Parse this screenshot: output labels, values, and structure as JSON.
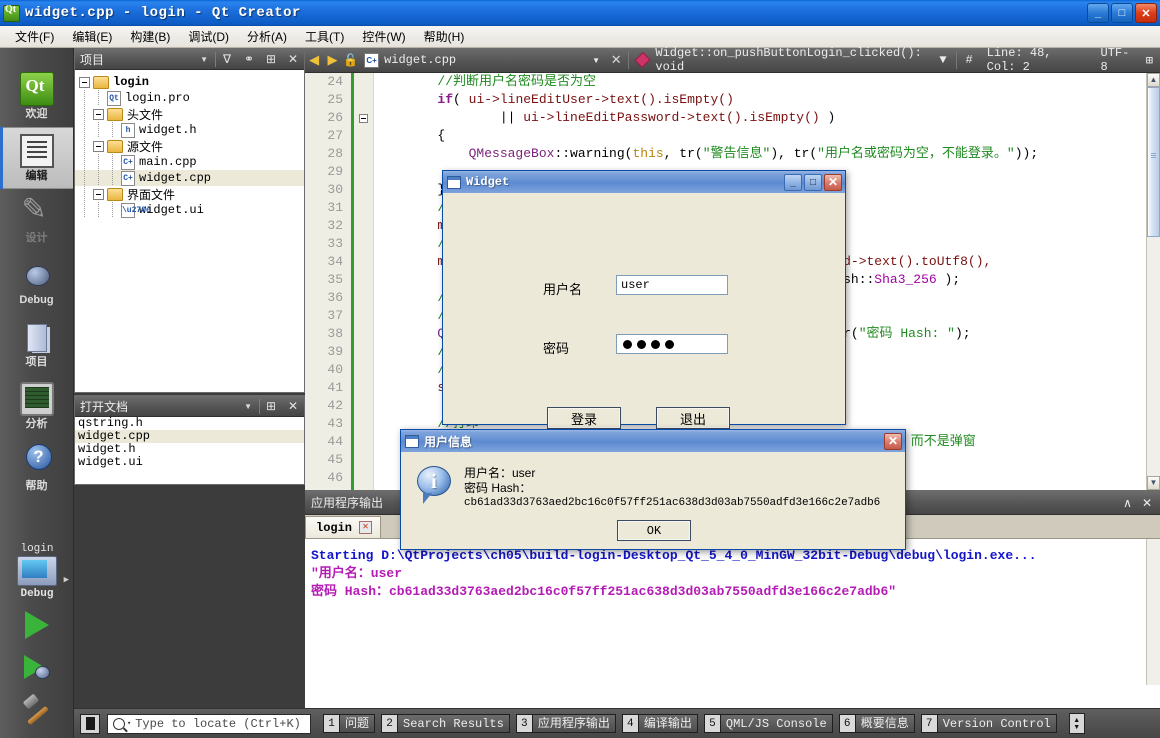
{
  "window": {
    "title": "widget.cpp - login - Qt Creator",
    "icon": "qt-logo-icon",
    "minimize": "_",
    "maximize": "□",
    "close": "✕"
  },
  "menubar": {
    "items": [
      {
        "label": "文件(F)"
      },
      {
        "label": "编辑(E)"
      },
      {
        "label": "构建(B)"
      },
      {
        "label": "调试(D)"
      },
      {
        "label": "分析(A)"
      },
      {
        "label": "工具(T)"
      },
      {
        "label": "控件(W)"
      },
      {
        "label": "帮助(H)"
      }
    ]
  },
  "modebar": {
    "items": [
      {
        "label": "欢迎",
        "icon": "qt-logo-icon",
        "state": "normal"
      },
      {
        "label": "编辑",
        "icon": "edit-lines-icon",
        "state": "active"
      },
      {
        "label": "设计",
        "icon": "design-pencil-icon",
        "state": "disabled"
      },
      {
        "label": "Debug",
        "icon": "bug-icon",
        "state": "normal"
      },
      {
        "label": "项目",
        "icon": "projects-book-icon",
        "state": "normal"
      },
      {
        "label": "分析",
        "icon": "analyze-monitor-icon",
        "state": "normal"
      },
      {
        "label": "帮助",
        "icon": "help-question-icon",
        "state": "normal"
      }
    ],
    "kit": {
      "project": "login",
      "icon": "computer-kit-icon",
      "build_config": "Debug",
      "arrow": "▶"
    },
    "run_buttons": [
      {
        "name": "run-button",
        "icon": "green-play-icon"
      },
      {
        "name": "debug-button",
        "icon": "green-play-bug-icon"
      },
      {
        "name": "build-button",
        "icon": "hammer-icon"
      }
    ]
  },
  "project_dock": {
    "title": "项目",
    "caret": "▼",
    "toolbar": [
      {
        "name": "filter-icon",
        "glyph": "∇"
      },
      {
        "name": "link-icon",
        "glyph": "⚭"
      },
      {
        "name": "split-icon",
        "glyph": "⊞"
      },
      {
        "name": "close-icon",
        "glyph": "✕"
      }
    ],
    "tree": [
      {
        "label": "login",
        "depth": 0,
        "expander": true,
        "icon": "qt-project-folder-icon",
        "bold": true,
        "selected": false
      },
      {
        "label": "login.pro",
        "depth": 1,
        "expander": false,
        "icon": "pro-file-icon",
        "bold": false,
        "selected": false
      },
      {
        "label": "头文件",
        "depth": 1,
        "expander": true,
        "icon": "folder-h-icon",
        "bold": false,
        "selected": false
      },
      {
        "label": "widget.h",
        "depth": 2,
        "expander": false,
        "icon": "h-file-icon",
        "bold": false,
        "selected": false
      },
      {
        "label": "源文件",
        "depth": 1,
        "expander": true,
        "icon": "folder-cpp-icon",
        "bold": false,
        "selected": false
      },
      {
        "label": "main.cpp",
        "depth": 2,
        "expander": false,
        "icon": "cpp-file-icon",
        "bold": false,
        "selected": false
      },
      {
        "label": "widget.cpp",
        "depth": 2,
        "expander": false,
        "icon": "cpp-file-icon",
        "bold": false,
        "selected": true
      },
      {
        "label": "界面文件",
        "depth": 1,
        "expander": true,
        "icon": "folder-ui-icon",
        "bold": false,
        "selected": false
      },
      {
        "label": "widget.ui",
        "depth": 2,
        "expander": false,
        "icon": "ui-file-icon",
        "bold": false,
        "selected": false
      }
    ]
  },
  "opendocs_dock": {
    "title": "打开文档",
    "caret": "▼",
    "toolbar": [
      {
        "name": "split-icon",
        "glyph": "⊞"
      },
      {
        "name": "close-icon",
        "glyph": "✕"
      }
    ],
    "items": [
      {
        "label": "qstring.h",
        "selected": false
      },
      {
        "label": "widget.cpp",
        "selected": true
      },
      {
        "label": "widget.h",
        "selected": false
      },
      {
        "label": "widget.ui",
        "selected": false
      }
    ]
  },
  "editor": {
    "toolbar": {
      "back_icon": "◀",
      "forward_icon": "▶",
      "lock_icon": "🔓",
      "file_icon": "cpp-file-icon",
      "filename": "widget.cpp",
      "file_caret": "▼",
      "close_icon": "✕",
      "symbol_icon": "method-symbol-icon",
      "symbol": "Widget::on_pushButtonLogin_clicked(): void",
      "symbol_caret": "▼",
      "line_col_icon": "#",
      "line_col": "Line: 48, Col: 2",
      "encoding": "UTF-8",
      "split_icon": "⊞"
    },
    "first_line": 24,
    "lines": [
      {
        "no": 24,
        "fold": false,
        "segs": [
          {
            "t": "        ",
            "c": "plain"
          },
          {
            "t": "//判断用户名密码是否为空",
            "c": "cmt"
          }
        ]
      },
      {
        "no": 25,
        "fold": false,
        "segs": [
          {
            "t": "        ",
            "c": "plain"
          },
          {
            "t": "if",
            "c": "kw"
          },
          {
            "t": "( ",
            "c": "plain"
          },
          {
            "t": "ui->lineEditUser->text().isEmpty()",
            "c": "txt"
          }
        ]
      },
      {
        "no": 26,
        "fold": true,
        "segs": [
          {
            "t": "                || ",
            "c": "plain"
          },
          {
            "t": "ui->lineEditPassword->text().isEmpty()",
            "c": "txt"
          },
          {
            "t": " )",
            "c": "plain"
          }
        ]
      },
      {
        "no": 27,
        "fold": false,
        "segs": [
          {
            "t": "        {",
            "c": "plain"
          }
        ]
      },
      {
        "no": 28,
        "fold": false,
        "segs": [
          {
            "t": "            ",
            "c": "plain"
          },
          {
            "t": "QMessageBox",
            "c": "fn"
          },
          {
            "t": "::warning(",
            "c": "plain"
          },
          {
            "t": "this",
            "c": "this"
          },
          {
            "t": ", tr(",
            "c": "plain"
          },
          {
            "t": "\"警告信息\"",
            "c": "str"
          },
          {
            "t": "), tr(",
            "c": "plain"
          },
          {
            "t": "\"用户名或密码为空，不能登录。\"",
            "c": "str"
          },
          {
            "t": "));",
            "c": "plain"
          }
        ]
      },
      {
        "no": 29,
        "fold": false,
        "segs": []
      },
      {
        "no": 30,
        "fold": false,
        "segs": [
          {
            "t": "        }",
            "c": "plain"
          }
        ]
      },
      {
        "no": 31,
        "fold": false,
        "segs": [
          {
            "t": "        ",
            "c": "plain"
          },
          {
            "t": "//用户",
            "c": "cmt"
          }
        ]
      },
      {
        "no": 32,
        "fold": false,
        "segs": [
          {
            "t": "        ",
            "c": "plain"
          },
          {
            "t": "m_st",
            "c": "txt"
          }
        ]
      },
      {
        "no": 33,
        "fold": false,
        "segs": [
          {
            "t": "        ",
            "c": "plain"
          },
          {
            "t": "//计",
            "c": "cmt"
          }
        ]
      },
      {
        "no": 34,
        "fold": false,
        "segs": [
          {
            "t": "        ",
            "c": "plain"
          },
          {
            "t": "m_pa",
            "c": "txt"
          },
          {
            "t": "                                   ",
            "c": "plain"
          },
          {
            "t": "neEditPassword->text().toUtf8(),",
            "c": "txt"
          }
        ]
      },
      {
        "no": 35,
        "fold": false,
        "segs": [
          {
            "t": "                                                  ",
            "c": "plain"
          },
          {
            "t": "ographicHash::",
            "c": "plain"
          },
          {
            "t": "Sha3_256",
            "c": "type"
          },
          {
            "t": " );",
            "c": "plain"
          }
        ]
      },
      {
        "no": 36,
        "fold": false,
        "segs": [
          {
            "t": "        ",
            "c": "plain"
          },
          {
            "t": "//构造",
            "c": "cmt"
          }
        ]
      },
      {
        "no": 37,
        "fold": false,
        "segs": [
          {
            "t": "        ",
            "c": "plain"
          },
          {
            "t": "//添加",
            "c": "cmt"
          }
        ]
      },
      {
        "no": 38,
        "fold": false,
        "segs": [
          {
            "t": "        ",
            "c": "plain"
          },
          {
            "t": "QStr",
            "c": "fn"
          },
          {
            "t": "                                       ",
            "c": "plain"
          },
          {
            "t": "r\\n\") + tr(",
            "c": "plain"
          },
          {
            "t": "\"密码 Hash: \"",
            "c": "str"
          },
          {
            "t": ");",
            "c": "plain"
          }
        ]
      },
      {
        "no": 39,
        "fold": false,
        "segs": [
          {
            "t": "        ",
            "c": "plain"
          },
          {
            "t": "//把二",
            "c": "cmt"
          }
        ]
      },
      {
        "no": 40,
        "fold": false,
        "segs": [
          {
            "t": "        ",
            "c": "plain"
          },
          {
            "t": "// 2",
            "c": "cmt"
          }
        ]
      },
      {
        "no": 41,
        "fold": false,
        "segs": [
          {
            "t": "        ",
            "c": "plain"
          },
          {
            "t": "strM",
            "c": "txt"
          }
        ]
      },
      {
        "no": 42,
        "fold": false,
        "segs": []
      },
      {
        "no": 43,
        "fold": false,
        "segs": [
          {
            "t": "        ",
            "c": "plain"
          },
          {
            "t": "//打印",
            "c": "cmt"
          }
        ]
      },
      {
        "no": 44,
        "fold": false,
        "segs": [
          {
            "t": "                                                         ",
            "c": "plain"
          },
          {
            "t": "件里的做比较，而不是弹窗",
            "c": "cmt"
          }
        ]
      },
      {
        "no": 45,
        "fold": false,
        "segs": []
      },
      {
        "no": 46,
        "fold": false,
        "segs": []
      }
    ],
    "scrollbar": {
      "up": "▲",
      "down": "▼"
    }
  },
  "widget_dialog": {
    "title": "Widget",
    "icon": "window-icon",
    "buttons": {
      "minimize": "_",
      "maximize": "□",
      "close": "✕"
    },
    "username_label": "用户名",
    "username_value": "user",
    "password_label": "密码",
    "password_dots": 4,
    "login_button": "登录",
    "exit_button": "退出"
  },
  "messagebox": {
    "title": "用户信息",
    "icon": "window-icon",
    "close": "✕",
    "info_icon": "information-icon",
    "line1": "用户名：user",
    "line2": "密码 Hash：",
    "hash": "cb61ad33d3763aed2bc16c0f57ff251ac638d3d03ab7550adfd3e166c2e7adb6",
    "ok_button": "OK"
  },
  "output_pane": {
    "title": "应用程序输出",
    "header_icons": [
      {
        "name": "minimize-pane-icon",
        "glyph": "∧"
      },
      {
        "name": "close-pane-icon",
        "glyph": "✕"
      }
    ],
    "tab": {
      "label": "login",
      "close": "✕"
    },
    "lines": [
      {
        "text": "Starting D:\\QtProjects\\ch05\\build-login-Desktop_Qt_5_4_0_MinGW_32bit-Debug\\debug\\login.exe...",
        "color": "blue"
      },
      {
        "text": "\"用户名：user",
        "color": "mag"
      },
      {
        "text": "密码 Hash：cb61ad33d3763aed2bc16c0f57ff251ac638d3d03ab7550adfd3e166c2e7adb6\"",
        "color": "mag"
      }
    ]
  },
  "statusbar": {
    "toggle_icon": "toggle-sidebar-icon",
    "locator": {
      "icon": "search-icon",
      "caret": "▾",
      "placeholder": "Type to locate (Ctrl+K)",
      "value": ""
    },
    "output_buttons": [
      {
        "num": "1",
        "label": "问题"
      },
      {
        "num": "2",
        "label": "Search Results"
      },
      {
        "num": "3",
        "label": "应用程序输出"
      },
      {
        "num": "4",
        "label": "编译输出"
      },
      {
        "num": "5",
        "label": "QML/JS Console"
      },
      {
        "num": "6",
        "label": "概要信息"
      },
      {
        "num": "7",
        "label": "Version Control"
      }
    ],
    "spinner": {
      "up": "▲",
      "down": "▼"
    }
  },
  "colors": {
    "titlebar_blue": "#1c6fdd",
    "dialog_face": "#ece9d8",
    "accent_green": "#2f9e2f",
    "comment_green": "#1f8a1f",
    "output_blue": "#1414cc",
    "output_magenta": "#b41ab4"
  }
}
